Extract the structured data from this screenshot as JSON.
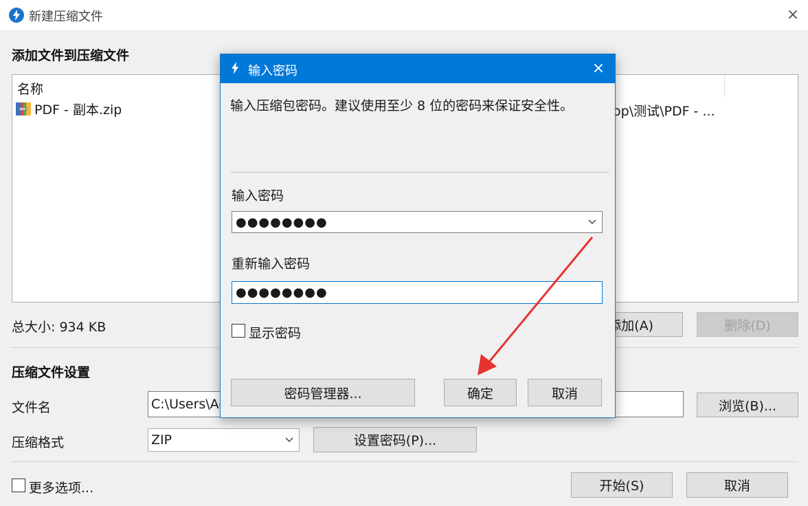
{
  "window": {
    "title": "新建压缩文件",
    "close_icon": "×"
  },
  "add_section": {
    "title": "添加文件到压缩文件",
    "list": {
      "column_header": "名称",
      "rows": [
        {
          "name": "PDF - 副本.zip",
          "path": "op\\测试\\PDF - ..."
        }
      ]
    },
    "total_size": "总大小: 934 KB",
    "add_button": "添加(A)",
    "delete_button": "删除(D)"
  },
  "settings_section": {
    "title": "压缩文件设置",
    "filename_label": "文件名",
    "filename_value": "C:\\Users\\Ac",
    "browse_button": "浏览(B)...",
    "format_label": "压缩格式",
    "format_value": "ZIP",
    "set_password_button": "设置密码(P)..."
  },
  "footer": {
    "more_options_label": "更多选项...",
    "start_button": "开始(S)",
    "cancel_button": "取消"
  },
  "dialog": {
    "title": "输入密码",
    "close_icon": "×",
    "description": "输入压缩包密码。建议使用至少 8 位的密码来保证安全性。",
    "password_label": "输入密码",
    "password_value": "●●●●●●●●",
    "confirm_label": "重新输入密码",
    "confirm_value": "●●●●●●●●",
    "show_password_label": "显示密码",
    "password_manager_button": "密码管理器...",
    "ok_button": "确定",
    "cancel_button": "取消"
  },
  "colors": {
    "accent": "#0078d7",
    "annotation_arrow": "#e8322f"
  }
}
